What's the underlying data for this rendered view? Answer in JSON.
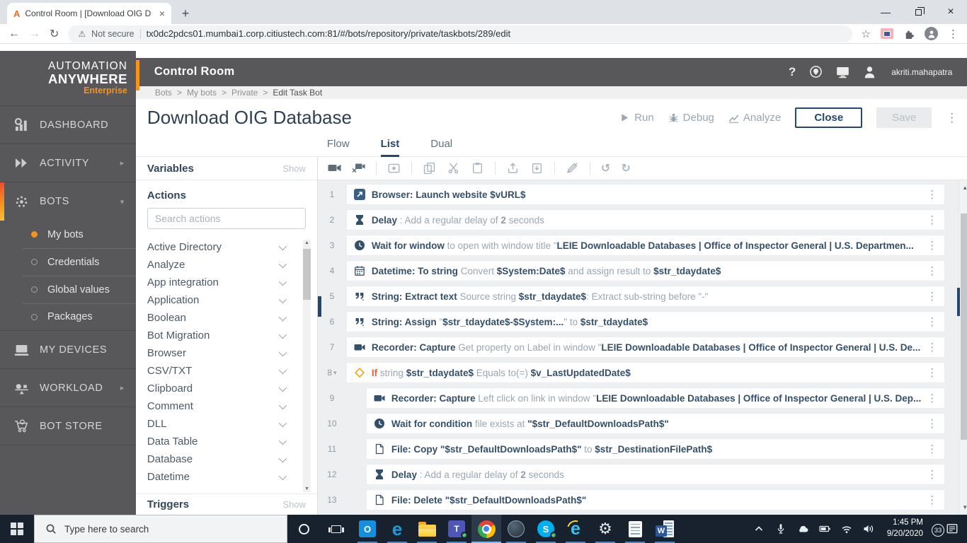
{
  "browser": {
    "tab_title": "Control Room | [Download OIG D",
    "tab_close": "×",
    "new_tab": "+",
    "not_secure_label": "Not secure",
    "url": "tx0dc2pdcs01.mumbai1.corp.citiustech.com:81/#/bots/repository/private/taskbots/289/edit"
  },
  "sidebar": {
    "logo": {
      "line1": "AUTOMATION",
      "line2": "ANYWHERE",
      "line3": "Enterprise"
    },
    "items": [
      {
        "id": "dashboard",
        "label": "DASHBOARD",
        "icon": "dashboard"
      },
      {
        "id": "activity",
        "label": "ACTIVITY",
        "icon": "activity",
        "chevron": "right"
      },
      {
        "id": "bots",
        "label": "BOTS",
        "icon": "bots",
        "chevron": "down",
        "active": true
      },
      {
        "id": "my-bots",
        "label": "My bots",
        "sub": true,
        "selected": true
      },
      {
        "id": "credentials",
        "label": "Credentials",
        "sub": true
      },
      {
        "id": "global-values",
        "label": "Global values",
        "sub": true
      },
      {
        "id": "packages",
        "label": "Packages",
        "sub": true
      },
      {
        "id": "my-devices",
        "label": "MY DEVICES",
        "icon": "devices"
      },
      {
        "id": "workload",
        "label": "WORKLOAD",
        "icon": "workload",
        "chevron": "right"
      },
      {
        "id": "bot-store",
        "label": "BOT STORE",
        "icon": "cart"
      }
    ]
  },
  "header": {
    "title": "Control Room",
    "help": "?",
    "username": "akriti.mahapatra"
  },
  "breadcrumb": {
    "items": [
      "Bots",
      "My bots",
      "Private"
    ],
    "current": "Edit Task Bot",
    "separator": ">"
  },
  "page": {
    "title": "Download OIG Database",
    "run": "Run",
    "debug": "Debug",
    "analyze": "Analyze",
    "close": "Close",
    "save": "Save",
    "tabs": [
      {
        "label": "Flow"
      },
      {
        "label": "List",
        "active": true
      },
      {
        "label": "Dual"
      }
    ]
  },
  "palette": {
    "accent_orange": "#F6921E",
    "navy": "#33506B",
    "if_orange": "#E8612C",
    "taskbar_underline": "#78B9E8"
  },
  "actions_panel": {
    "variables_title": "Variables",
    "variables_show": "Show",
    "actions_title": "Actions",
    "search_placeholder": "Search actions",
    "categories": [
      "Active Directory",
      "Analyze",
      "App integration",
      "Application",
      "Boolean",
      "Bot Migration",
      "Browser",
      "CSV/TXT",
      "Clipboard",
      "Comment",
      "DLL",
      "Data Table",
      "Database",
      "Datetime"
    ],
    "triggers_title": "Triggers",
    "triggers_show": "Show"
  },
  "toolbar": {
    "icons": [
      "record",
      "camera-x",
      "|",
      "snap",
      "|",
      "copy",
      "scissors",
      "paste",
      "|",
      "upload",
      "download",
      "|",
      "pen-slash",
      "|",
      "undo",
      "redo"
    ]
  },
  "action_list": {
    "rows": [
      {
        "num": "1",
        "icon": "launch",
        "segments": [
          {
            "t": "Browser: Launch website ",
            "s": "b"
          },
          {
            "t": "$vURL$",
            "s": "v"
          }
        ]
      },
      {
        "num": "2",
        "icon": "hourglass",
        "segments": [
          {
            "t": "Delay",
            "s": "b"
          },
          {
            "t": " : Add a regular delay of ",
            "s": "g"
          },
          {
            "t": "2",
            "s": "gb"
          },
          {
            "t": " seconds",
            "s": "g"
          }
        ]
      },
      {
        "num": "3",
        "icon": "clock",
        "segments": [
          {
            "t": "Wait for window",
            "s": "b"
          },
          {
            "t": " to open with window title \"",
            "s": "g"
          },
          {
            "t": "LEIE Downloadable Databases | Office of Inspector General | U.S. Departmen...",
            "s": "v"
          }
        ]
      },
      {
        "num": "4",
        "icon": "calendar",
        "segments": [
          {
            "t": "Datetime: To string",
            "s": "b"
          },
          {
            "t": " Convert ",
            "s": "g"
          },
          {
            "t": "$System:Date$",
            "s": "v"
          },
          {
            "t": " and assign result to ",
            "s": "g"
          },
          {
            "t": "$str_tdaydate$",
            "s": "v"
          }
        ]
      },
      {
        "num": "5",
        "icon": "quotes",
        "segments": [
          {
            "t": "String: Extract text",
            "s": "b"
          },
          {
            "t": " Source string ",
            "s": "g"
          },
          {
            "t": "$str_tdaydate$",
            "s": "v"
          },
          {
            "t": ": Extract sub-string before \"-\"",
            "s": "g"
          }
        ]
      },
      {
        "num": "6",
        "icon": "quotes",
        "segments": [
          {
            "t": "String: Assign",
            "s": "b"
          },
          {
            "t": " \"",
            "s": "g"
          },
          {
            "t": "$str_tdaydate$-$System:...",
            "s": "v"
          },
          {
            "t": "\" to ",
            "s": "g"
          },
          {
            "t": "$str_tdaydate$",
            "s": "v"
          }
        ]
      },
      {
        "num": "7",
        "icon": "videocam",
        "segments": [
          {
            "t": "Recorder: Capture",
            "s": "b"
          },
          {
            "t": " Get property on Label in window \"",
            "s": "g"
          },
          {
            "t": "LEIE Downloadable Databases | Office of Inspector General | U.S. De...",
            "s": "v"
          }
        ]
      },
      {
        "num": "8",
        "icon": "diamond",
        "expander": true,
        "segments": [
          {
            "t": "If",
            "s": "o"
          },
          {
            "t": " string ",
            "s": "g"
          },
          {
            "t": "$str_tdaydate$",
            "s": "v"
          },
          {
            "t": " Equals to(=) ",
            "s": "g"
          },
          {
            "t": "$v_LastUpdatedDate$",
            "s": "v"
          }
        ]
      },
      {
        "num": "9",
        "icon": "videocam",
        "indent": true,
        "segments": [
          {
            "t": "Recorder: Capture",
            "s": "b"
          },
          {
            "t": " Left click on link in window \"",
            "s": "g"
          },
          {
            "t": "LEIE Downloadable Databases | Office of Inspector General | U.S. Dep...",
            "s": "v"
          }
        ]
      },
      {
        "num": "10",
        "icon": "clock",
        "indent": true,
        "segments": [
          {
            "t": "Wait for condition",
            "s": "b"
          },
          {
            "t": " file exists at ",
            "s": "g"
          },
          {
            "t": "\"$str_DefaultDownloadsPath$\"",
            "s": "v"
          }
        ]
      },
      {
        "num": "11",
        "icon": "file",
        "indent": true,
        "segments": [
          {
            "t": "File: Copy",
            "s": "b"
          },
          {
            "t": " \"$str_DefaultDownloadsPath$\"",
            "s": "v"
          },
          {
            "t": " to ",
            "s": "g"
          },
          {
            "t": "$str_DestinationFilePath$",
            "s": "v"
          }
        ]
      },
      {
        "num": "12",
        "icon": "hourglass",
        "indent": true,
        "segments": [
          {
            "t": "Delay",
            "s": "b"
          },
          {
            "t": " : Add a regular delay of ",
            "s": "g"
          },
          {
            "t": "2",
            "s": "gb"
          },
          {
            "t": " seconds",
            "s": "g"
          }
        ]
      },
      {
        "num": "13",
        "icon": "file",
        "indent": true,
        "segments": [
          {
            "t": "File: Delete",
            "s": "b"
          },
          {
            "t": " \"$str_DefaultDownloadsPath$\"",
            "s": "v"
          }
        ]
      }
    ]
  },
  "taskbar": {
    "search_placeholder": "Type here to search",
    "apps": [
      "outlook",
      "edge",
      "file-explorer",
      "teams",
      "chrome",
      "anyconnect",
      "skype",
      "internet-explorer",
      "settings",
      "notepad",
      "word"
    ],
    "active_app": "chrome",
    "app_glyphs": {
      "outlook": "O",
      "edge": "e",
      "teams": "T",
      "skype": "S",
      "internet-explorer": "e",
      "word": "W",
      "settings": "⚙"
    },
    "tray_icons": [
      "chevron-up",
      "mic",
      "onedrive",
      "battery",
      "wifi",
      "speaker"
    ],
    "time": "1:45 PM",
    "date": "9/20/2020",
    "notification_badge": "33"
  }
}
